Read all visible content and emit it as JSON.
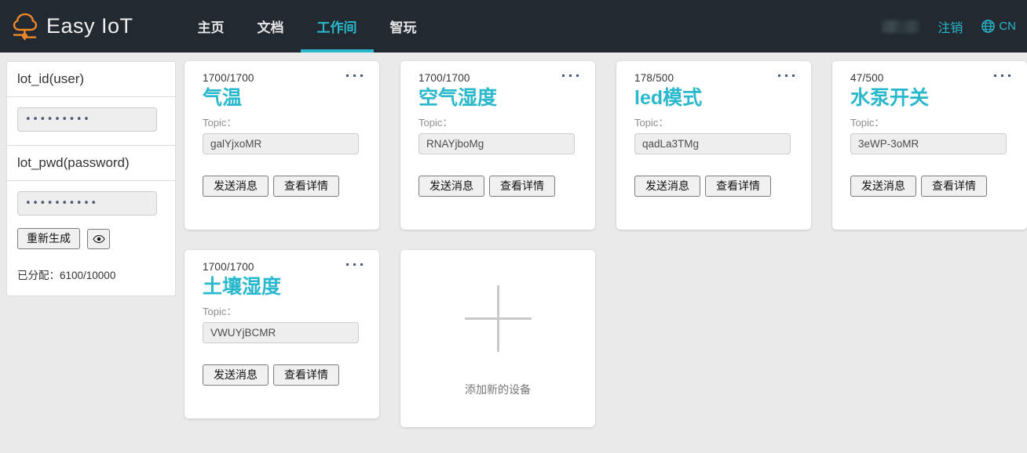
{
  "header": {
    "brand": "Easy IoT",
    "logo_icon": "cloud-tree-icon",
    "nav": [
      {
        "label": "主页",
        "active": false
      },
      {
        "label": "文档",
        "active": false
      },
      {
        "label": "工作间",
        "active": true
      },
      {
        "label": "智玩",
        "active": false
      }
    ],
    "username_redacted": "",
    "logout_label": "注销",
    "language_label": "CN",
    "language_icon": "globe-icon",
    "accent_color": "#2ab8cc",
    "background_color": "#232931",
    "logo_color": "#f0892b"
  },
  "sidebar": {
    "id_section": {
      "title": "lot_id(user)",
      "value": "•••••••••"
    },
    "pwd_section": {
      "title": "lot_pwd(password)",
      "value": "••••••••••",
      "regenerate_label": "重新生成",
      "toggle_visibility_icon": "eye-icon"
    },
    "allocation_label": "已分配：",
    "allocation_value": "6100/10000"
  },
  "main": {
    "topic_label": "Topic：",
    "send_label": "发送消息",
    "details_label": "查看详情",
    "menu_icon": "ellipsis-icon",
    "devices": [
      {
        "count": "1700/1700",
        "name": "气温",
        "topic": "galYjxoMR"
      },
      {
        "count": "1700/1700",
        "name": "空气湿度",
        "topic": "RNAYjboMg"
      },
      {
        "count": "178/500",
        "name": "led模式",
        "topic": "qadLa3TMg"
      },
      {
        "count": "47/500",
        "name": "水泵开关",
        "topic": "3eWP-3oMR"
      },
      {
        "count": "1700/1700",
        "name": "土壤湿度",
        "topic": "VWUYjBCMR"
      }
    ],
    "add_card": {
      "label": "添加新的设备",
      "icon": "plus-icon"
    }
  }
}
